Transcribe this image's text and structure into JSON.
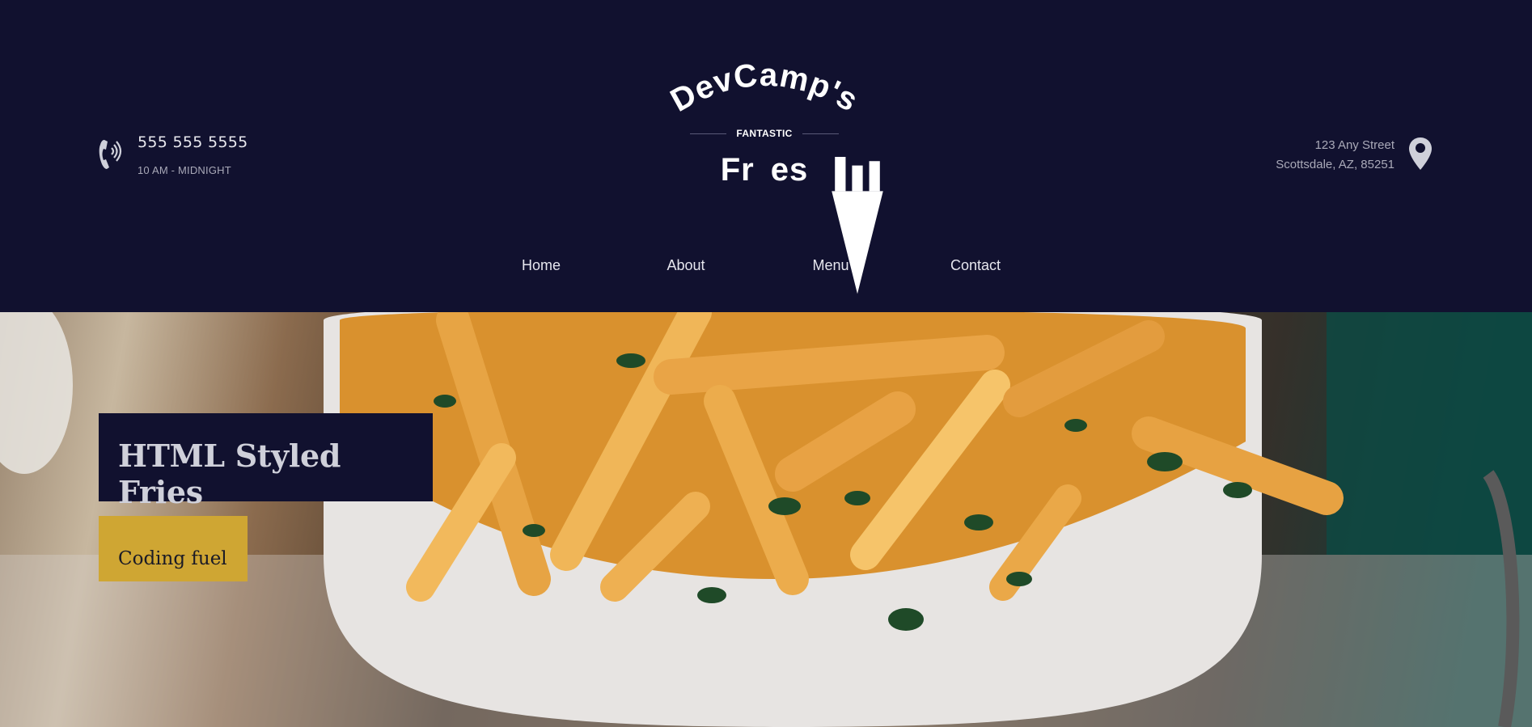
{
  "header": {
    "phone": {
      "number": "555 555 5555",
      "hours": "10 AM - MIDNIGHT",
      "icon": "phone-icon"
    },
    "logo": {
      "brand": "DevCamp's",
      "tag": "FANTASTIC",
      "product": "Fries",
      "product_fill": "i"
    },
    "address": {
      "line1": "123 Any Street",
      "line2": "Scottsdale, AZ, 85251",
      "icon": "map-pin-icon"
    }
  },
  "nav": {
    "items": [
      "Home",
      "About",
      "Menu",
      "Contact"
    ]
  },
  "hero": {
    "title": "HTML Styled Fries",
    "button": "Coding fuel"
  },
  "colors": {
    "header_bg": "#11112f",
    "accent_gold": "#cfa633",
    "text_light": "#e6e6ee",
    "text_muted": "#a9a9b8"
  }
}
